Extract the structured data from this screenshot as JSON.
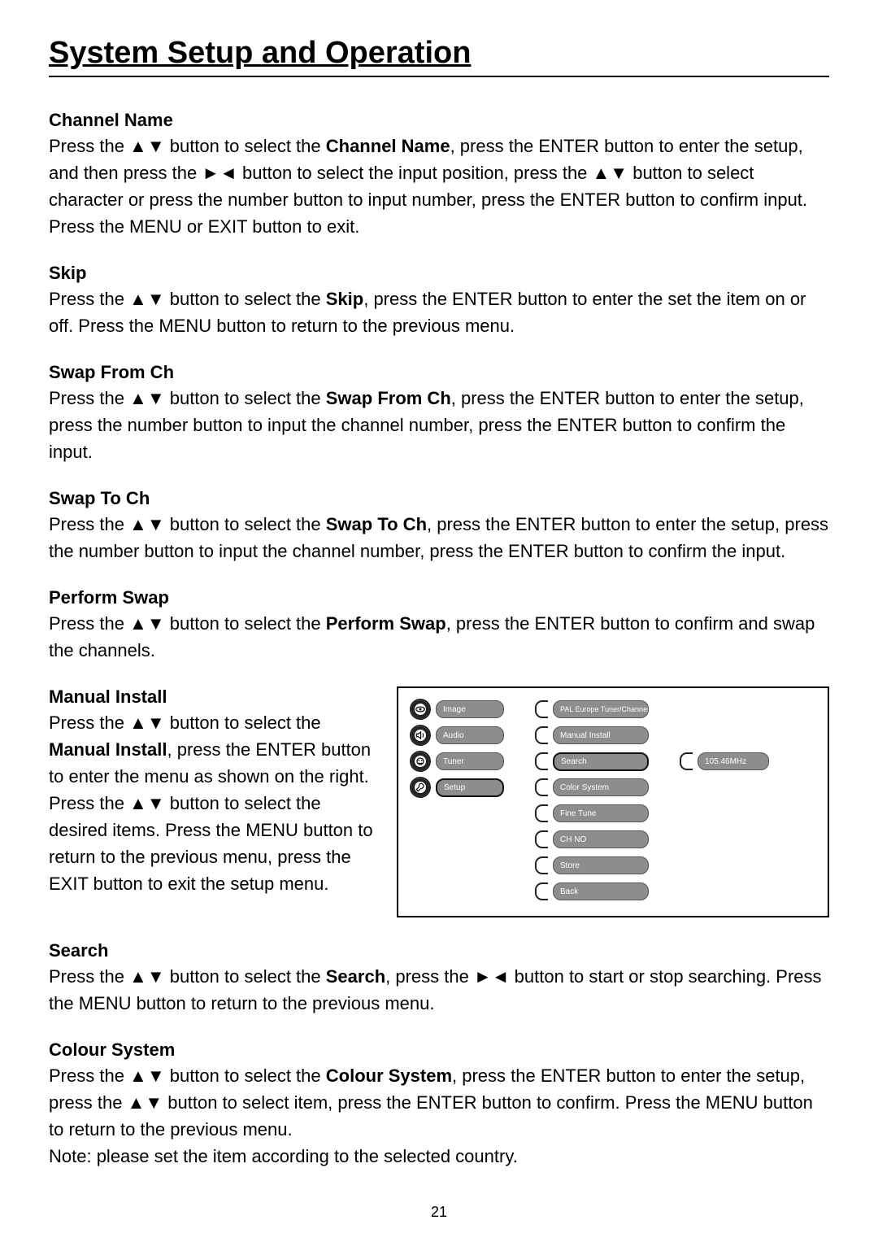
{
  "page_number": "21",
  "title": "System Setup and Operation",
  "arrows": {
    "ud": "▲▼",
    "rl": "►◄",
    "lr": "►◄"
  },
  "sections": {
    "channel_name": {
      "heading": "Channel Name",
      "p1a": "Press the ",
      "p1b": " button to select the ",
      "p1bold": "Channel Name",
      "p1c": ", press the ENTER button to enter the setup, and then press the ",
      "p1d": " button to select the input position, press the ",
      "p1e": " button to select character or press the number button to input number, press the ENTER button to confirm input. Press the MENU or EXIT button to exit."
    },
    "skip": {
      "heading": "Skip",
      "p1a": "Press the ",
      "p1b": "  button to select the ",
      "p1bold": "Skip",
      "p1c": ", press the ENTER button to enter the set the item on or off. Press the MENU button to return to the previous menu."
    },
    "swap_from": {
      "heading": "Swap From Ch",
      "p1a": "Press the ",
      "p1b": "  button to select the ",
      "p1bold": "Swap From Ch",
      "p1c": ", press the ENTER button to enter the setup, press the number button to input the channel number, press the ENTER button to confirm the input."
    },
    "swap_to": {
      "heading": "Swap To Ch",
      "p1a": "Press the ",
      "p1b": " button to select the ",
      "p1bold": "Swap To Ch",
      "p1c": ", press the ENTER button to enter the setup, press the number button to input the channel number, press the ENTER button to confirm the input."
    },
    "perform_swap": {
      "heading": "Perform Swap",
      "p1a": "Press the ",
      "p1b": " button to select the ",
      "p1bold": "Perform Swap",
      "p1c": ", press the ENTER button to confirm and swap the channels."
    },
    "manual_install": {
      "heading": "Manual Install",
      "p1a": "Press the ",
      "p1b": "  button to select the ",
      "p1bold": "Manual Install",
      "p1c": ", press the ENTER button to enter the menu as shown on the right. Press the ",
      "p1d": " button to select the desired items. Press the MENU button to return to the previous menu, press the EXIT button to exit the setup menu."
    },
    "search": {
      "heading": "Search",
      "p1a": "Press the ",
      "p1b": "  button to select the ",
      "p1bold": "Search",
      "p1c": ", press the ",
      "p1d": " button to start or stop searching. Press the MENU button to return to the previous menu."
    },
    "colour_system": {
      "heading": "Colour System",
      "p1a": "Press the ",
      "p1b": "  button to select the ",
      "p1bold": "Colour System",
      "p1c": ", press the ENTER button to enter the setup, press the ",
      "p1d": " button to select item, press the ENTER button to confirm. Press the MENU button to return to the previous menu.",
      "note": "Note: please set the item according to the selected country."
    }
  },
  "figure": {
    "left_menu": [
      "Image",
      "Audio",
      "Tuner",
      "Setup"
    ],
    "mid_menu": [
      "PAL Europe Tuner/Channel",
      "Manual Install",
      "Search",
      "Color System",
      "Fine Tune",
      "CH NO",
      "Store",
      "Back"
    ],
    "right_value": "105.46MHz"
  }
}
